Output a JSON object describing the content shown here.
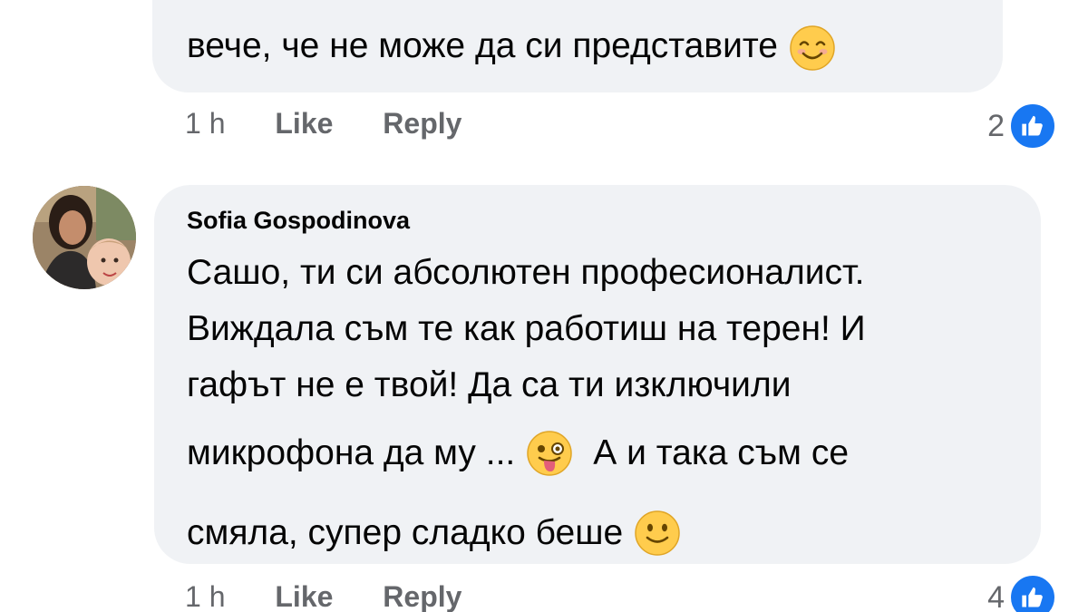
{
  "comments": [
    {
      "text_lines": [
        "вече, че не може да си представите"
      ],
      "time": "1 h",
      "like_label": "Like",
      "reply_label": "Reply",
      "reaction_count": "2"
    },
    {
      "author": "Sofia Gospodinova",
      "text_lines": [
        "Сашо, ти си абсолютен професионалист.",
        "Виждала съм те как работиш на терен! И",
        "гафът не е твой! Да са ти изключили",
        "микрофона да му ...",
        "А и така съм се",
        "смяла, супер сладко беше"
      ],
      "time": "1 h",
      "like_label": "Like",
      "reply_label": "Reply",
      "reaction_count": "4"
    }
  ],
  "icons": {
    "emoji_smile": "smiling-face-with-smiling-eyes",
    "emoji_wink": "winking-face-with-tongue",
    "emoji_slight": "slightly-smiling-face",
    "reaction": "like-thumb"
  },
  "colors": {
    "bubble": "#f0f2f5",
    "meta_text": "#65676b",
    "like_blue": "#1877f2",
    "emoji_yellow": "#ffcc4d"
  }
}
